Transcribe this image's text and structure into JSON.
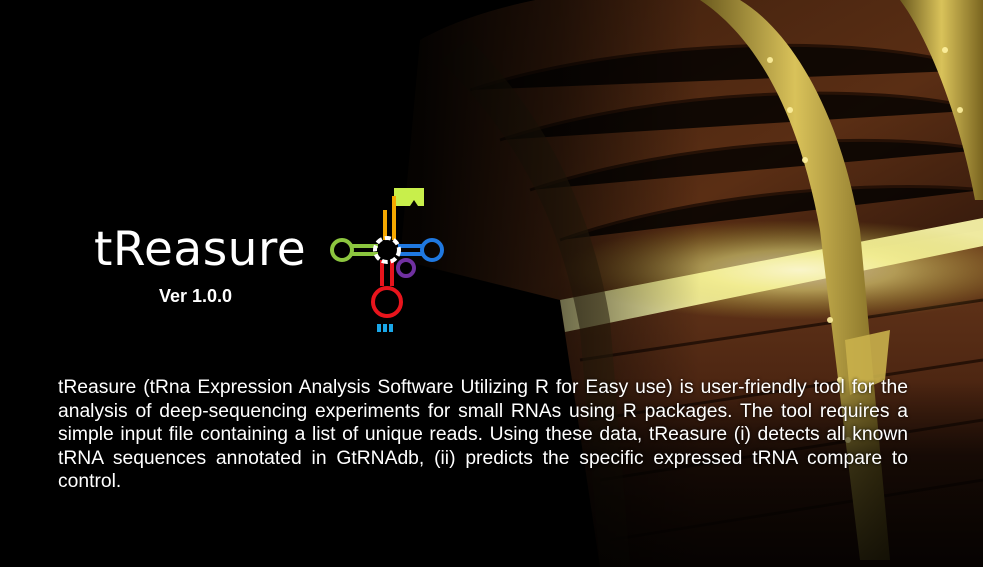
{
  "splash": {
    "app_title": "tReasure",
    "version": "Ver 1.0.0",
    "description": "tReasure (tRna Expression Analysis Software Utilizing R for Easy use) is user-friendly tool for the analysis of deep-sequencing experiments for small RNAs using R packages. The tool requires a simple input file containing a list of unique reads. Using these data, tReasure (i) detects all known tRNA sequences annotated in GtRNAdb, (ii) predicts the specific expressed tRNA compare to control."
  },
  "logo": {
    "colors": {
      "acceptor_stem": "#f5a800",
      "flag": "#c8ef4b",
      "d_arm": "#8cc63f",
      "t_arm": "#1f78e0",
      "variable_loop": "#7030a0",
      "anticodon_arm": "#e8141c",
      "anticodon_bars": "#1aa7e8",
      "core": "#ffffff"
    }
  }
}
